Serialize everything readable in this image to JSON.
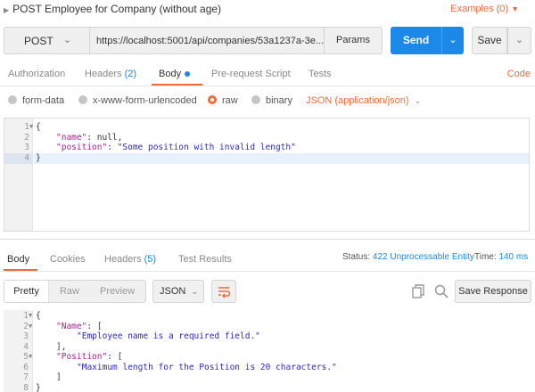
{
  "request": {
    "title": "POST Employee for Company (without age)",
    "examples_label": "Examples (0)",
    "method": "POST",
    "url": "https://localhost:5001/api/companies/53a1237a-3e...",
    "params_label": "Params",
    "send_label": "Send",
    "save_label": "Save",
    "code_label": "Code",
    "tabs": [
      {
        "label": "Authorization"
      },
      {
        "label": "Headers",
        "count": "(2)"
      },
      {
        "label": "Body"
      },
      {
        "label": "Pre-request Script"
      },
      {
        "label": "Tests"
      }
    ],
    "body_modes": [
      "form-data",
      "x-www-form-urlencoded",
      "raw",
      "binary"
    ],
    "selected_mode": "raw",
    "content_type": "JSON (application/json)",
    "body_lines": [
      {
        "n": "1",
        "text": "{"
      },
      {
        "n": "2",
        "key": "\"name\"",
        "rest": ": null,"
      },
      {
        "n": "3",
        "key": "\"position\"",
        "sep": ": ",
        "str": "\"Some position with invalid length\""
      },
      {
        "n": "4",
        "text": "}"
      }
    ]
  },
  "response": {
    "tabs": [
      {
        "label": "Body"
      },
      {
        "label": "Cookies"
      },
      {
        "label": "Headers",
        "count": "(5)"
      },
      {
        "label": "Test Results"
      }
    ],
    "status_label": "Status:",
    "status_value": "422 Unprocessable Entity",
    "time_label": "Time:",
    "time_value": "140 ms",
    "formats": [
      "Pretty",
      "Raw",
      "Preview"
    ],
    "language": "JSON",
    "save_response_label": "Save Response",
    "body_lines": [
      {
        "n": "1",
        "text": "{"
      },
      {
        "n": "2",
        "key": "\"Name\"",
        "rest": ": ["
      },
      {
        "n": "3",
        "str": "\"Employee name is a required field.\""
      },
      {
        "n": "4",
        "text": "],"
      },
      {
        "n": "5",
        "key": "\"Position\"",
        "rest": ": ["
      },
      {
        "n": "6",
        "str": "\"Maximum length for the Position is 20 characters.\""
      },
      {
        "n": "7",
        "text": "]"
      },
      {
        "n": "8",
        "text": "}"
      }
    ]
  },
  "colors": {
    "accent": "#f26b3a",
    "primary": "#1c88e8",
    "json_key": "#a3228d",
    "json_string": "#2b2bbf"
  },
  "icons": [
    "caret-right-icon",
    "chevron-down-icon",
    "wrap-lines-icon",
    "copy-icon",
    "search-icon"
  ]
}
